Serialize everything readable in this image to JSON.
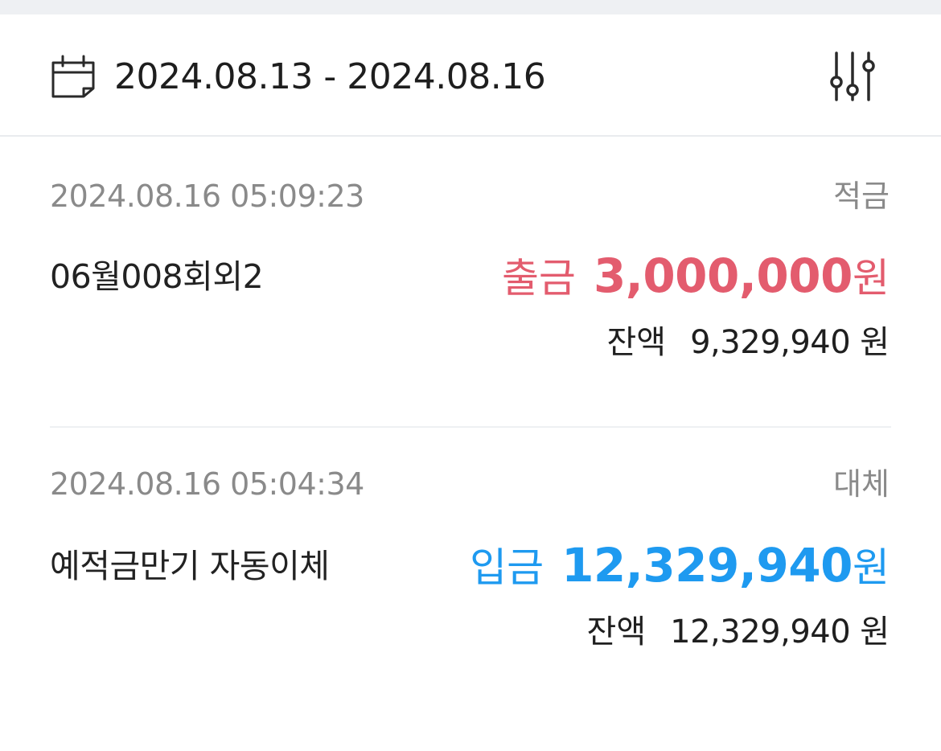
{
  "filter": {
    "calendar_icon": "calendar-icon",
    "date_range": "2024.08.13 - 2024.08.16",
    "filter_icon": "sliders-icon"
  },
  "colors": {
    "withdrawal": "#e35c6e",
    "deposit": "#1e9af0",
    "muted": "#8a8a8a"
  },
  "transactions": [
    {
      "datetime": "2024.08.16 05:09:23",
      "category": "적금",
      "description": "06월008회외2",
      "kind": "출금",
      "amount": "3,000,000",
      "amount_unit": "원",
      "balance_label": "잔액",
      "balance": "9,329,940",
      "balance_unit": "원"
    },
    {
      "datetime": "2024.08.16 05:04:34",
      "category": "대체",
      "description": "예적금만기 자동이체",
      "kind": "입금",
      "amount": "12,329,940",
      "amount_unit": "원",
      "balance_label": "잔액",
      "balance": "12,329,940",
      "balance_unit": "원"
    }
  ]
}
